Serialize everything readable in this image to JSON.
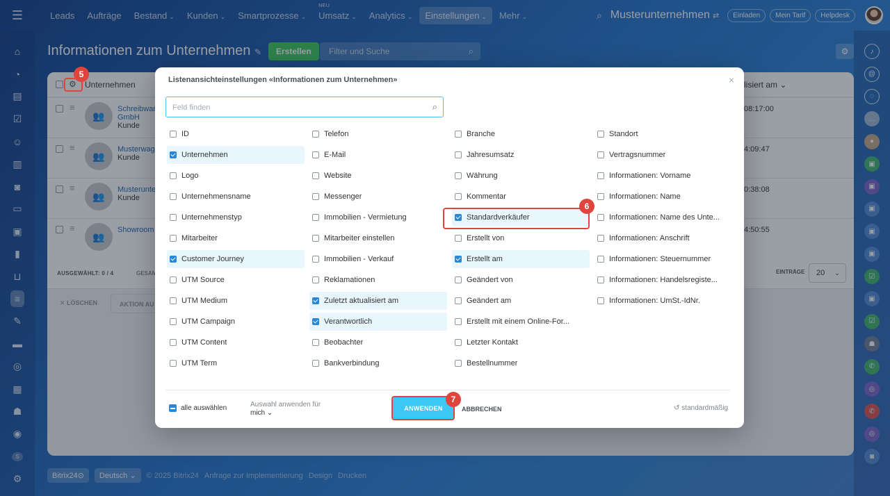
{
  "topnav": {
    "items": [
      {
        "label": "Leads",
        "dropdown": false
      },
      {
        "label": "Aufträge",
        "dropdown": false
      },
      {
        "label": "Bestand",
        "dropdown": true
      },
      {
        "label": "Kunden",
        "dropdown": true
      },
      {
        "label": "Smartprozesse",
        "dropdown": true
      },
      {
        "label": "Umsatz",
        "dropdown": true,
        "badge": "NEU"
      },
      {
        "label": "Analytics",
        "dropdown": true
      },
      {
        "label": "Einstellungen",
        "dropdown": true,
        "active": true
      },
      {
        "label": "Mehr",
        "dropdown": true
      }
    ],
    "company": "Musterunternehmen",
    "invite": "Einladen",
    "tariff": "Mein Tarif",
    "helpdesk": "Helpdesk"
  },
  "page": {
    "title": "Informationen zum Unternehmen",
    "create_label": "Erstellen",
    "filter_placeholder": "Filter und Suche"
  },
  "table": {
    "col_company": "Unternehmen",
    "col_updated": "lisiert am",
    "rows": [
      {
        "name": "Schreibwar GmbH",
        "type": "Kunde",
        "time": "08:17:00"
      },
      {
        "name": "Musterwag",
        "type": "Kunde",
        "time": "4:09:47"
      },
      {
        "name": "Musterunte",
        "type": "Kunde",
        "time": "0:38:08"
      },
      {
        "name": "Showroom",
        "type": "",
        "time": "4:50:55"
      }
    ],
    "selected": "AUSGEWÄHLT: 0 / 4",
    "total": "GESAM",
    "entries_label": "EINTRÄGE",
    "entries_value": "20",
    "delete_label": "LÖSCHEN",
    "action_label": "AKTION AU"
  },
  "modal": {
    "title": "Listenansichteinstellungen «Informationen zum Unternehmen»",
    "search_placeholder": "Feld finden",
    "columns": [
      [
        {
          "label": "ID",
          "checked": false
        },
        {
          "label": "Unternehmen",
          "checked": true
        },
        {
          "label": "Logo",
          "checked": false
        },
        {
          "label": "Unternehmensname",
          "checked": false
        },
        {
          "label": "Unternehmenstyp",
          "checked": false
        },
        {
          "label": "Mitarbeiter",
          "checked": false
        },
        {
          "label": "Customer Journey",
          "checked": true
        },
        {
          "label": "UTM Source",
          "checked": false
        },
        {
          "label": "UTM Medium",
          "checked": false
        },
        {
          "label": "UTM Campaign",
          "checked": false
        },
        {
          "label": "UTM Content",
          "checked": false
        },
        {
          "label": "UTM Term",
          "checked": false
        }
      ],
      [
        {
          "label": "Telefon",
          "checked": false
        },
        {
          "label": "E-Mail",
          "checked": false
        },
        {
          "label": "Website",
          "checked": false
        },
        {
          "label": "Messenger",
          "checked": false
        },
        {
          "label": "Immobilien - Vermietung",
          "checked": false
        },
        {
          "label": "Mitarbeiter einstellen",
          "checked": false
        },
        {
          "label": "Immobilien - Verkauf",
          "checked": false
        },
        {
          "label": "Reklamationen",
          "checked": false
        },
        {
          "label": "Zuletzt aktualisiert am",
          "checked": true
        },
        {
          "label": "Verantwortlich",
          "checked": true
        },
        {
          "label": "Beobachter",
          "checked": false
        },
        {
          "label": "Bankverbindung",
          "checked": false
        }
      ],
      [
        {
          "label": "Branche",
          "checked": false
        },
        {
          "label": "Jahresumsatz",
          "checked": false
        },
        {
          "label": "Währung",
          "checked": false
        },
        {
          "label": "Kommentar",
          "checked": false
        },
        {
          "label": "Standardverkäufer",
          "checked": true
        },
        {
          "label": "Erstellt von",
          "checked": false
        },
        {
          "label": "Erstellt am",
          "checked": true
        },
        {
          "label": "Geändert von",
          "checked": false
        },
        {
          "label": "Geändert am",
          "checked": false
        },
        {
          "label": "Erstellt mit einem Online-For...",
          "checked": false
        },
        {
          "label": "Letzter Kontakt",
          "checked": false
        },
        {
          "label": "Bestellnummer",
          "checked": false
        }
      ],
      [
        {
          "label": "Standort",
          "checked": false
        },
        {
          "label": "Vertragsnummer",
          "checked": false
        },
        {
          "label": "Informationen: Vorname",
          "checked": false
        },
        {
          "label": "Informationen: Name",
          "checked": false
        },
        {
          "label": "Informationen: Name des Unte...",
          "checked": false
        },
        {
          "label": "Informationen: Anschrift",
          "checked": false
        },
        {
          "label": "Informationen: Steuernummer",
          "checked": false
        },
        {
          "label": "Informationen: Handelsregiste...",
          "checked": false
        },
        {
          "label": "Informationen: UmSt.-IdNr.",
          "checked": false
        }
      ]
    ],
    "select_all": "alle auswählen",
    "apply_for_label": "Auswahl anwenden für",
    "apply_for_value": "mich",
    "apply": "ANWENDEN",
    "cancel": "ABBRECHEN",
    "default": "standardmäßig"
  },
  "annotations": [
    "5",
    "6",
    "7"
  ],
  "footer": {
    "brand": "Bitrix24",
    "language": "Deutsch",
    "copyright": "© 2025 Bitrix24",
    "links": [
      "Anfrage zur Implementierung",
      "Design",
      "Drucken"
    ]
  },
  "sidebar_user_initial": "S",
  "colors": {
    "accent": "#2a86d6",
    "apply": "#3bc8f5",
    "create": "#3bc85a",
    "annotation": "#e0453d"
  }
}
